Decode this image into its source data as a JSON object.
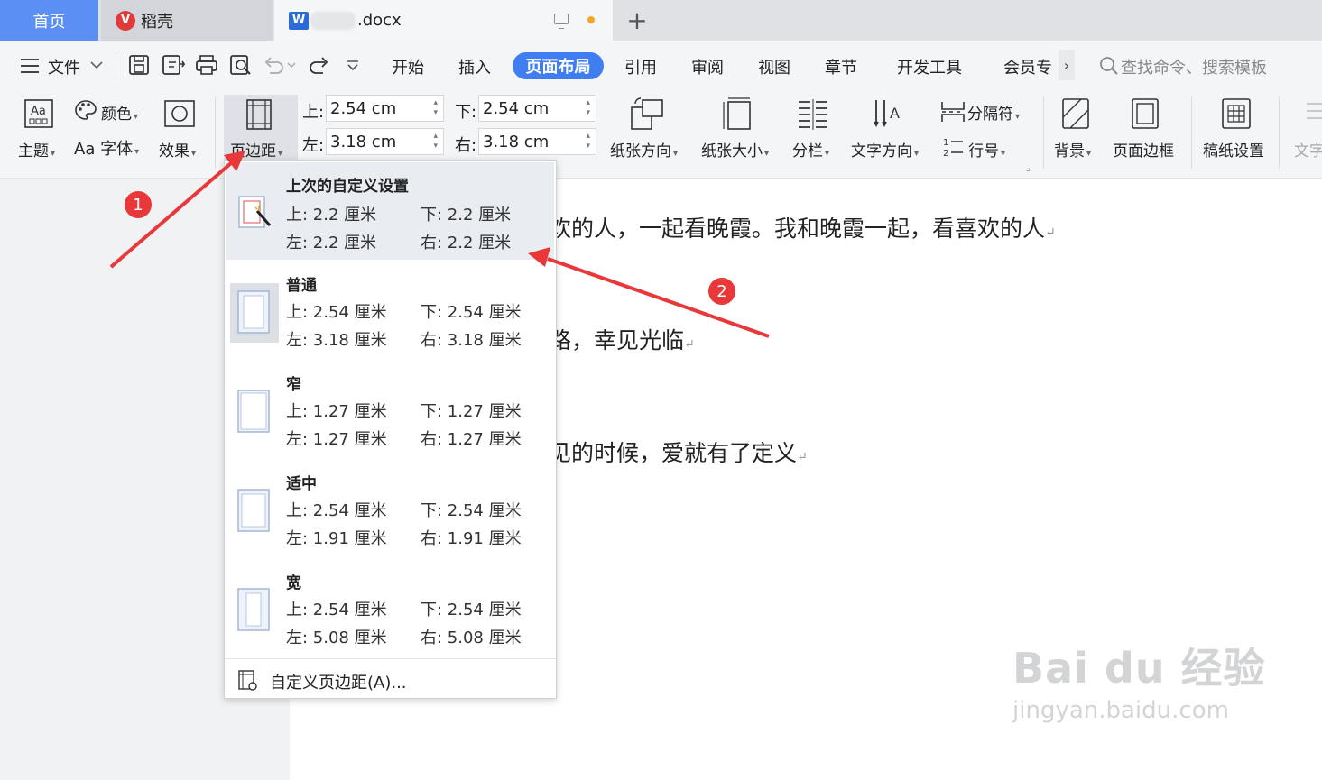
{
  "tabs": {
    "home": "首页",
    "daoke": "稻壳",
    "doc_name": ".docx",
    "new_tab": "+"
  },
  "menu": {
    "file": "文件",
    "items": [
      "开始",
      "插入",
      "页面布局",
      "引用",
      "审阅",
      "视图",
      "章节",
      "开发工具",
      "会员专"
    ],
    "active": "页面布局",
    "search_placeholder": "查找命令、搜索模板"
  },
  "ribbon": {
    "theme": "主题",
    "color": "颜色",
    "font": "Aa 字体",
    "effect": "效果",
    "margins": "页边距",
    "top_label": "上:",
    "top_value": "2.54 cm",
    "bottom_label": "下:",
    "bottom_value": "2.54 cm",
    "left_label": "左:",
    "left_value": "3.18 cm",
    "right_label": "右:",
    "right_value": "3.18 cm",
    "orientation": "纸张方向",
    "size": "纸张大小",
    "columns": "分栏",
    "text_direction": "文字方向",
    "separator": "分隔符",
    "line_number": "行号",
    "background": "背景",
    "page_border": "页面边框",
    "manuscript": "稿纸设置",
    "text_cut": "文字"
  },
  "document": {
    "line1": "欢的人，一起看晚霞。我和晚霞一起，看喜欢的人",
    "line2": "路，幸见光临",
    "line3": "见的时候，爱就有了定义"
  },
  "margin_menu": {
    "presets": [
      {
        "title": "上次的自定义设置",
        "top": "上: 2.2 厘米",
        "bottom": "下: 2.2 厘米",
        "left": "左: 2.2 厘米",
        "right": "右: 2.2 厘米"
      },
      {
        "title": "普通",
        "top": "上: 2.54 厘米",
        "bottom": "下: 2.54 厘米",
        "left": "左: 3.18 厘米",
        "right": "右: 3.18 厘米"
      },
      {
        "title": "窄",
        "top": "上: 1.27 厘米",
        "bottom": "下: 1.27 厘米",
        "left": "左: 1.27 厘米",
        "right": "右: 1.27 厘米"
      },
      {
        "title": "适中",
        "top": "上: 2.54 厘米",
        "bottom": "下: 2.54 厘米",
        "left": "左: 1.91 厘米",
        "right": "右: 1.91 厘米"
      },
      {
        "title": "宽",
        "top": "上: 2.54 厘米",
        "bottom": "下: 2.54 厘米",
        "left": "左: 5.08 厘米",
        "right": "右: 5.08 厘米"
      }
    ],
    "custom": "自定义页边距(A)..."
  },
  "annotations": {
    "badge1": "1",
    "badge2": "2",
    "arrow_color": "#e8383a"
  },
  "watermark": {
    "brand": "Bai du 经验",
    "url": "jingyan.baidu.com"
  },
  "colors": {
    "accent": "#3f7df0",
    "home_tab": "#5b8ff4"
  }
}
